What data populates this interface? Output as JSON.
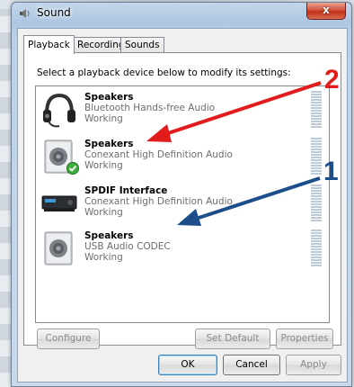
{
  "window": {
    "title": "Sound",
    "close_label": "x"
  },
  "tabs": [
    {
      "label": "Playback",
      "active": true
    },
    {
      "label": "Recording",
      "active": false
    },
    {
      "label": "Sounds",
      "active": false
    }
  ],
  "instruction": "Select a playback device below to modify its settings:",
  "devices": [
    {
      "name": "Speakers",
      "description": "Bluetooth Hands-free Audio",
      "status": "Working",
      "icon": "headset-icon",
      "default": false
    },
    {
      "name": "Speakers",
      "description": "Conexant High Definition Audio",
      "status": "Working",
      "icon": "speaker-icon",
      "default": true
    },
    {
      "name": "SPDIF Interface",
      "description": "Conexant High Definition Audio",
      "status": "Working",
      "icon": "spdif-receiver-icon",
      "default": false
    },
    {
      "name": "Speakers",
      "description": "USB Audio CODEC",
      "status": "Working",
      "icon": "speaker-icon",
      "default": false
    }
  ],
  "buttons": {
    "configure": "Configure",
    "set_default": "Set Default",
    "properties": "Properties",
    "ok": "OK",
    "cancel": "Cancel",
    "apply": "Apply"
  },
  "annotations": [
    {
      "label": "2",
      "color": "#e21b1b"
    },
    {
      "label": "1",
      "color": "#1c4e8c"
    }
  ]
}
